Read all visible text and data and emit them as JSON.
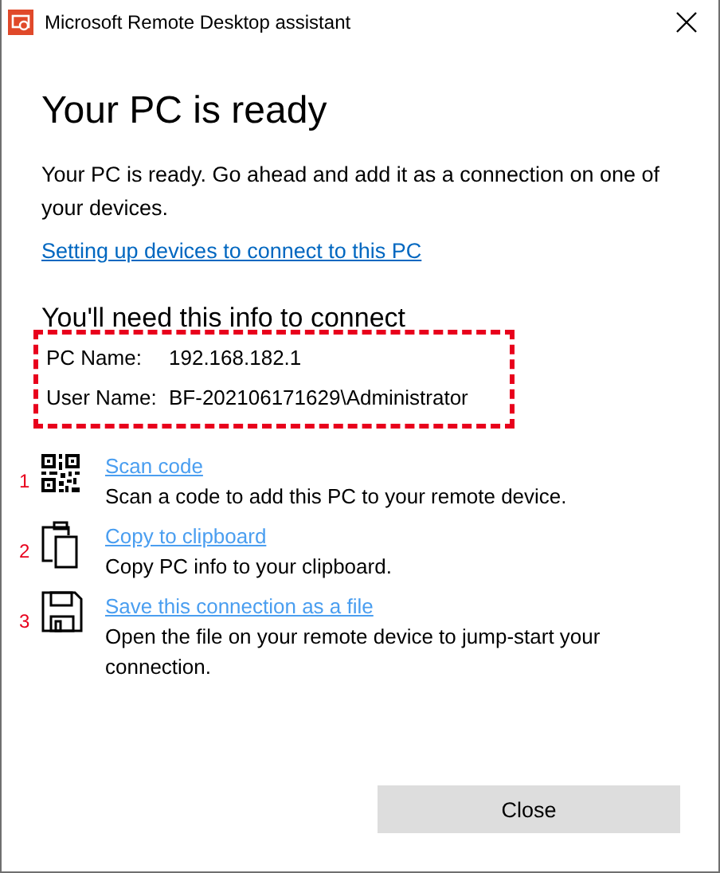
{
  "window": {
    "title": "Microsoft Remote Desktop assistant"
  },
  "heading": "Your PC is ready",
  "description": "Your PC is ready. Go ahead and add it as a connection on one of your devices.",
  "help_link": "Setting up devices to connect to this PC",
  "info": {
    "heading": "You'll need this info to connect",
    "highlighted": true,
    "fields": [
      {
        "label": "PC Name:",
        "value": "192.168.182.1"
      },
      {
        "label": "User Name:",
        "value": "BF-202106171629\\Administrator"
      }
    ]
  },
  "actions": [
    {
      "kind": "qr",
      "number": "1",
      "title": "Scan code",
      "description": "Scan a code to add this PC to your remote device."
    },
    {
      "kind": "clipboard",
      "number": "2",
      "title": "Copy to clipboard",
      "description": "Copy PC info to your clipboard."
    },
    {
      "kind": "save",
      "number": "3",
      "title": "Save this connection as a file",
      "description": "Open the file on your remote device to jump-start your connection."
    }
  ],
  "buttons": [
    "Close"
  ]
}
